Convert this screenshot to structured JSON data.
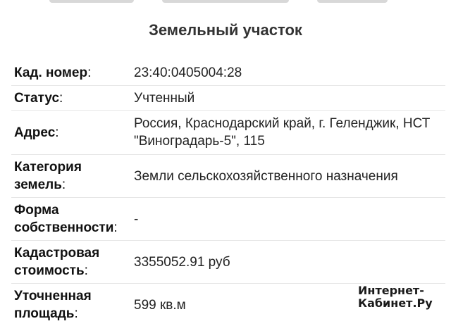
{
  "header": {
    "title": "Земельный участок"
  },
  "properties": [
    {
      "label": "Кад. номер",
      "value": "23:40:0405004:28"
    },
    {
      "label": "Статус",
      "value": "Учтенный"
    },
    {
      "label": "Адрес",
      "value": "Россия, Краснодарский край, г. Геленджик, НСТ \"Виноградарь-5\", 115"
    },
    {
      "label": "Категория земель",
      "value": "Земли сельскохозяйственного назначения"
    },
    {
      "label": "Форма собственности",
      "value": "-"
    },
    {
      "label": "Кадастровая стоимость",
      "value": "3355052.91 руб"
    },
    {
      "label": "Уточненная площадь",
      "value": "599 кв.м"
    }
  ],
  "watermark": {
    "line1": "Интернет-",
    "line2": "Кабинет.Ру"
  }
}
